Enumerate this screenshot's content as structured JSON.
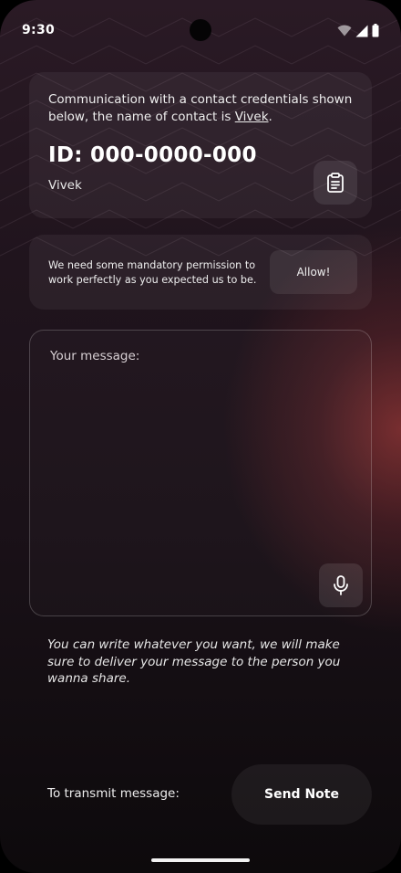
{
  "status_bar": {
    "time": "9:30",
    "icons": [
      "wifi-icon",
      "cellular-signal-icon",
      "battery-icon"
    ]
  },
  "contact_card": {
    "description_prefix": "Communication with a contact credentials shown below,  the name of contact is ",
    "description_link": "Vivek",
    "description_suffix": ".",
    "id_label": "ID: 000-0000-000",
    "contact_name": "Vivek",
    "copy_icon": "clipboard-icon"
  },
  "permission_card": {
    "text": "We need some mandatory permission to work perfectly as you expected us to be.",
    "allow_label": "Allow!"
  },
  "message_box": {
    "placeholder": "Your message:",
    "value": "",
    "mic_icon": "microphone-icon"
  },
  "hint": {
    "text": "You can write whatever you want, we will make sure to deliver your message to the person you wanna share."
  },
  "footer": {
    "transmit_label": "To transmit message:",
    "send_label": "Send Note"
  },
  "colors": {
    "background_top": "#2a1a25",
    "background_bottom": "#0d0a0c",
    "accent_glow": "#963737"
  }
}
